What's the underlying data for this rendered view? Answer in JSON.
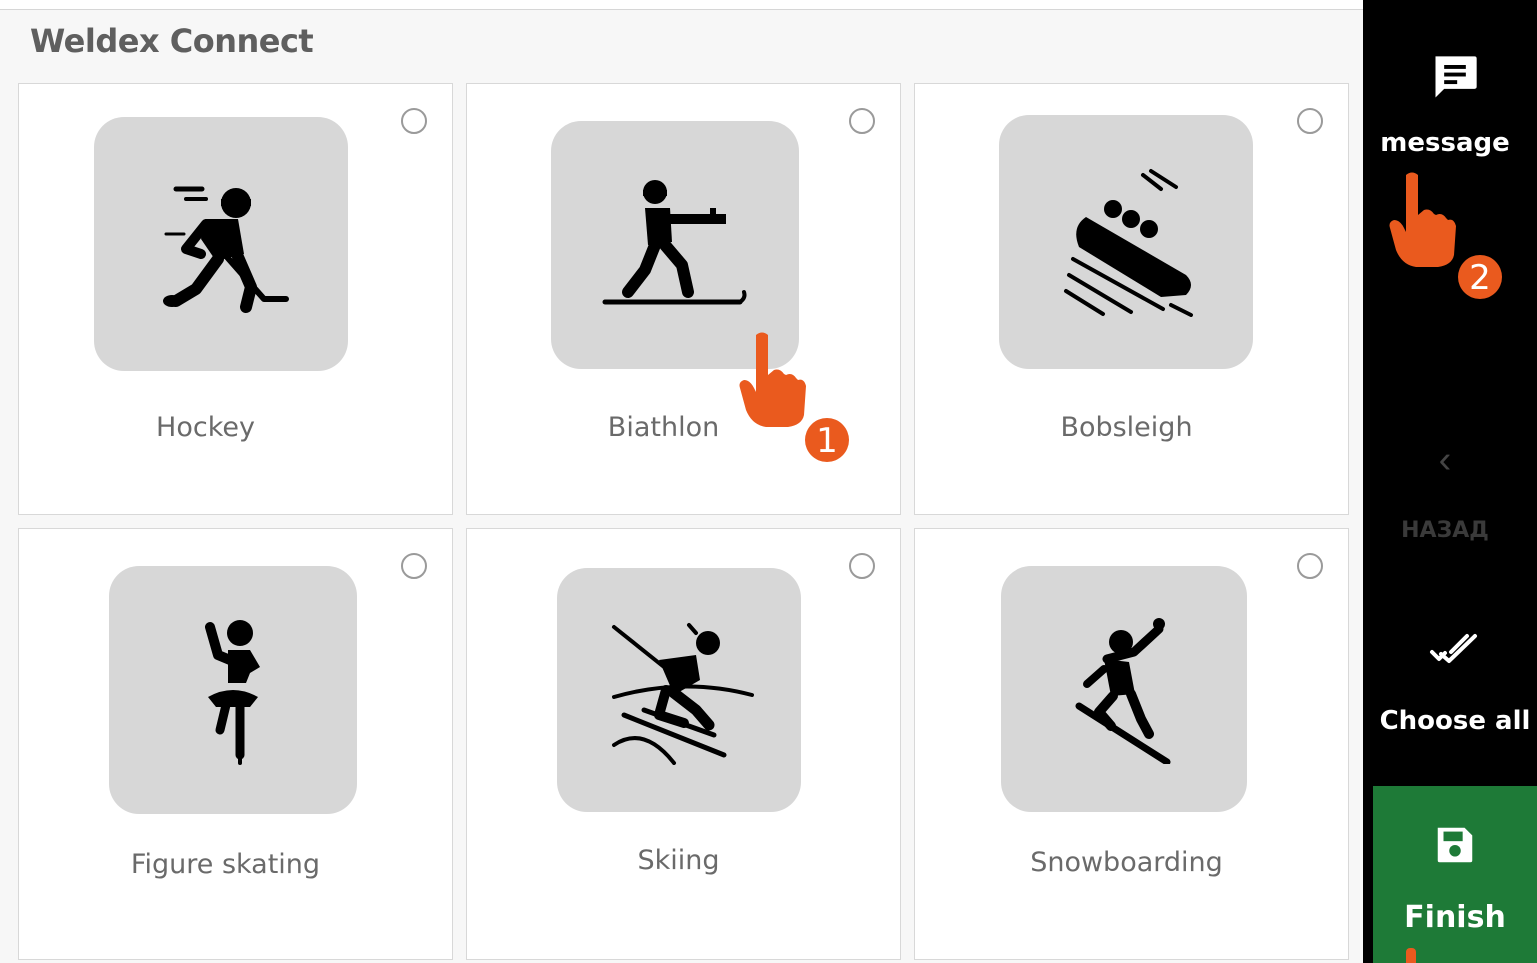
{
  "header": {
    "title": "Weldex Connect"
  },
  "cards": [
    {
      "label": "Hockey",
      "icon": "hockey-player-icon"
    },
    {
      "label": "Biathlon",
      "icon": "biathlon-icon"
    },
    {
      "label": "Bobsleigh",
      "icon": "bobsleigh-icon"
    },
    {
      "label": "Figure skating",
      "icon": "figure-skating-icon"
    },
    {
      "label": "Skiing",
      "icon": "skiing-icon"
    },
    {
      "label": "Snowboarding",
      "icon": "snowboarding-icon"
    }
  ],
  "sidebar": {
    "message_label": "message",
    "back_label": "НАЗАД",
    "choose_all_label": "Choose all",
    "finish_label": "Finish"
  },
  "markers": [
    {
      "number": "1"
    },
    {
      "number": "2"
    }
  ],
  "colors": {
    "accent": "#ea5a1e",
    "finish": "#1e7a37",
    "sidebar": "#000000",
    "tile": "#d7d7d7"
  }
}
